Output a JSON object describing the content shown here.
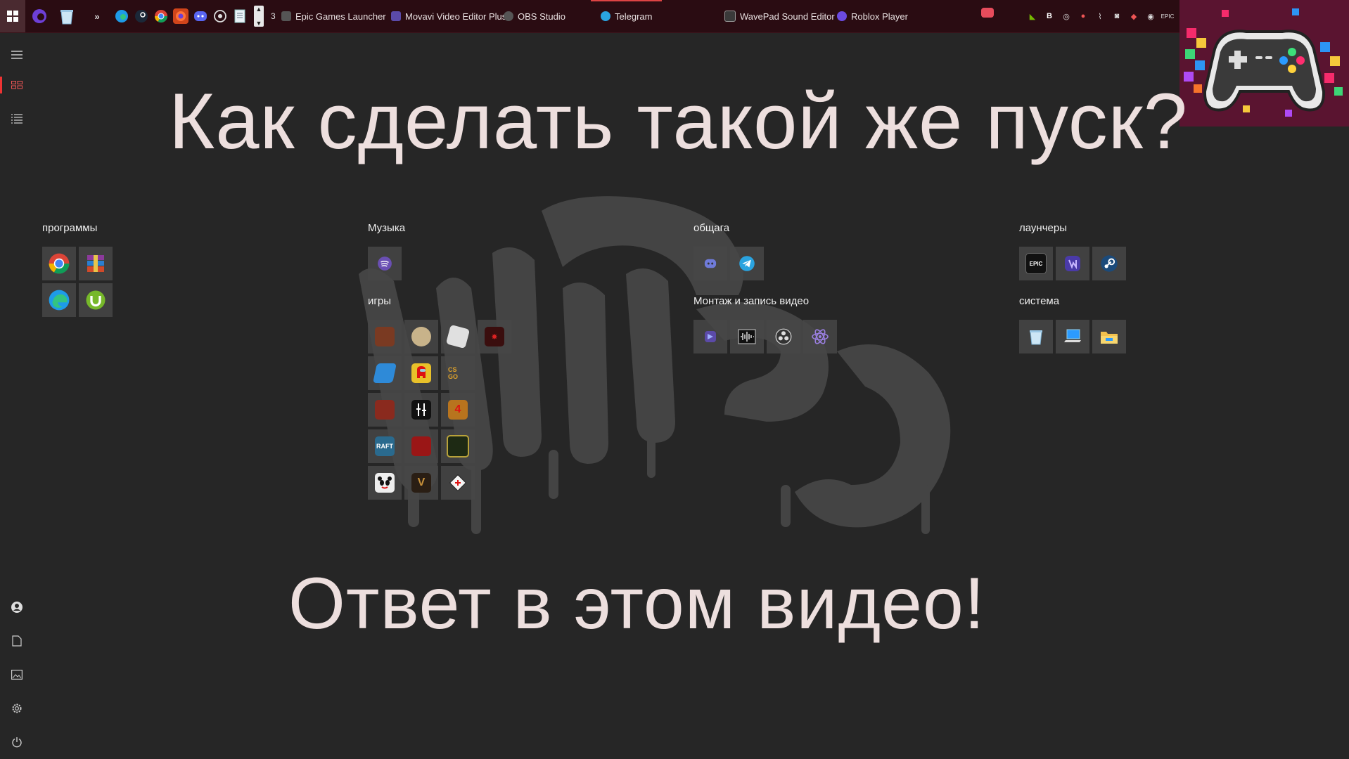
{
  "taskbar": {
    "hidden_count": "3",
    "overflow_glyph": "»",
    "apps": [
      {
        "label": "Epic Games Launcher",
        "color": "#444444",
        "running": false
      },
      {
        "label": "Movavi Video Editor Plus",
        "color": "#5b4aa8",
        "running": false
      },
      {
        "label": "OBS Studio",
        "color": "#555555",
        "running": false
      },
      {
        "label": "Telegram",
        "color": "#2aa3df",
        "running": true
      },
      {
        "label": "WavePad Sound Editor",
        "color": "#3a3a3a",
        "running": false
      },
      {
        "label": "Roblox Player",
        "color": "#6b4ae0",
        "running": false
      }
    ],
    "pinned_icons": [
      "edge-icon",
      "steam-icon",
      "chrome-icon",
      "browser-icon",
      "discord-icon",
      "obs-icon",
      "notepad-icon"
    ],
    "tray_icons": [
      "nvidia-icon",
      "bandicam-icon",
      "obs-tray-icon",
      "chrome-tray-icon",
      "network-icon",
      "discord-tray-icon",
      "game-tray-icon",
      "hotspot-icon",
      "epic-tray-icon"
    ]
  },
  "headline": {
    "top": "Как сделать такой же пуск?",
    "bottom": "Ответ в этом видео!"
  },
  "groups": {
    "programs": {
      "title": "программы"
    },
    "music": {
      "title": "Музыка"
    },
    "games": {
      "title": "игры"
    },
    "social": {
      "title": "общага"
    },
    "video": {
      "title": "Монтаж и запись видео"
    },
    "launchers": {
      "title": "лаунчеры"
    },
    "system": {
      "title": "система"
    }
  },
  "tiles": {
    "epic": "EPIC",
    "raft": "RAFT",
    "cs": "CS GO",
    "l4d": "4",
    "v": "V"
  },
  "colors": {
    "accent": "#e33333",
    "headline": "#eddfde",
    "background": "#262626",
    "taskbar": "#2a0c12"
  }
}
